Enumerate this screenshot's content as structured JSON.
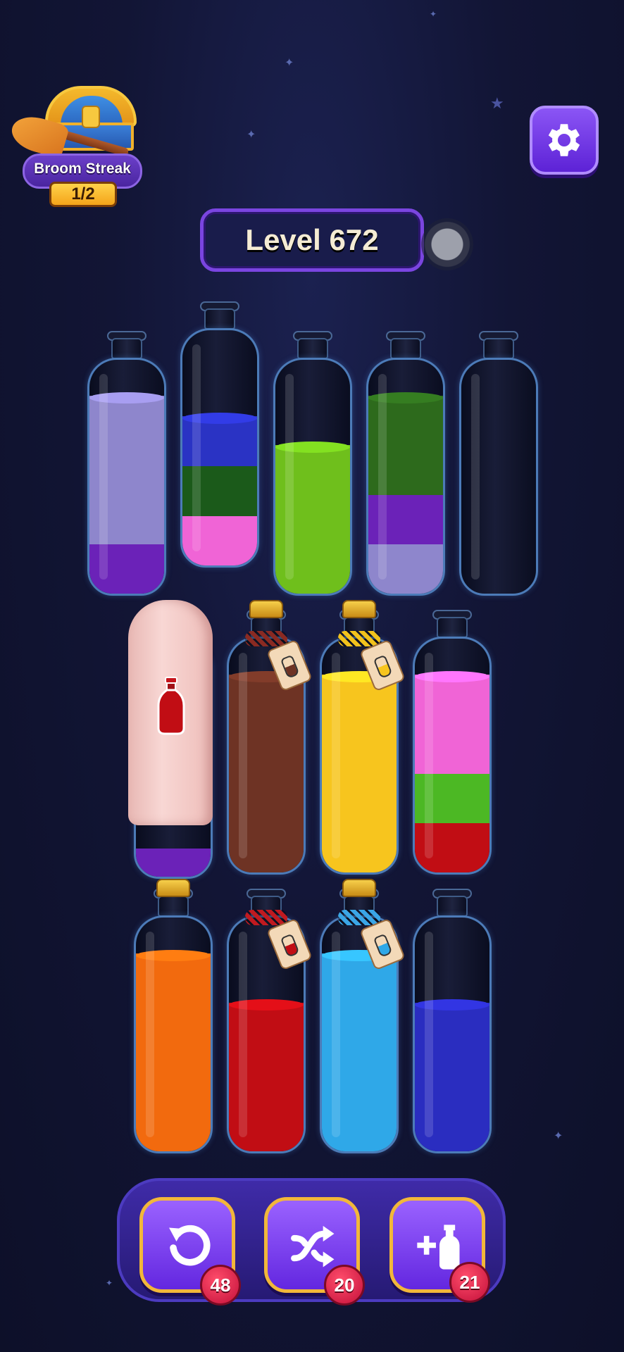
{
  "streak": {
    "label": "Broom Streak",
    "count": "1/2"
  },
  "level": {
    "label": "Level 672"
  },
  "toolbar": {
    "undo_count": "48",
    "shuffle_count": "20",
    "add_bottle_count": "21"
  },
  "colors": {
    "lavender": "#8e86cc",
    "purple": "#6b22b8",
    "blue": "#2a33c4",
    "dark_green": "#1b5a1a",
    "pink": "#f064d6",
    "lime": "#6fbf1c",
    "green": "#2d6a1c",
    "brown": "#6e3324",
    "yellow": "#f7c51e",
    "red": "#c10d14",
    "orange": "#f26a0e",
    "sky": "#2fa8e8",
    "indigo": "#2a2dc0",
    "light_green": "#4cb824"
  },
  "bottles": [
    {
      "row": 1,
      "layers_bottom_to_top": [
        "purple",
        "lavender",
        "lavender",
        "lavender"
      ],
      "fill_level": 0.88
    },
    {
      "row": 1,
      "layers_bottom_to_top": [
        "pink",
        "dark_green",
        "blue"
      ],
      "fill_level": 0.66
    },
    {
      "row": 1,
      "layers_bottom_to_top": [
        "lime",
        "lime",
        "lime"
      ],
      "fill_level": 0.66
    },
    {
      "row": 1,
      "layers_bottom_to_top": [
        "lavender",
        "purple",
        "green",
        "green"
      ],
      "fill_level": 0.88
    },
    {
      "row": 1,
      "layers_bottom_to_top": [],
      "fill_level": 0
    },
    {
      "row": 2,
      "state": "veiled",
      "hint_color": "red",
      "visible_bottom": "purple"
    },
    {
      "row": 2,
      "state": "corked",
      "rope_color": "brown",
      "layers_bottom_to_top": [
        "brown",
        "brown",
        "brown",
        "brown"
      ],
      "fill_level": 0.88
    },
    {
      "row": 2,
      "state": "corked",
      "rope_color": "yellow",
      "layers_bottom_to_top": [
        "yellow",
        "yellow",
        "yellow",
        "yellow"
      ],
      "fill_level": 0.88
    },
    {
      "row": 2,
      "layers_bottom_to_top": [
        "red",
        "light_green",
        "pink",
        "pink"
      ],
      "fill_level": 0.88
    },
    {
      "row": 3,
      "state": "corked",
      "rope_color": "none",
      "layers_bottom_to_top": [
        "orange",
        "orange",
        "orange",
        "orange"
      ],
      "fill_level": 0.88
    },
    {
      "row": 3,
      "state": "roped",
      "rope_color": "red",
      "layers_bottom_to_top": [
        "red",
        "red",
        "red"
      ],
      "fill_level": 0.66
    },
    {
      "row": 3,
      "state": "corked",
      "rope_color": "sky",
      "layers_bottom_to_top": [
        "sky",
        "sky",
        "sky",
        "sky"
      ],
      "fill_level": 0.88
    },
    {
      "row": 3,
      "layers_bottom_to_top": [
        "indigo",
        "indigo",
        "indigo"
      ],
      "fill_level": 0.66
    }
  ]
}
